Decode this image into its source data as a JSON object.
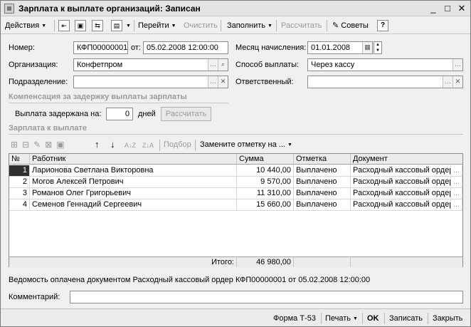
{
  "window": {
    "title": "Зарплата к выплате организаций: Записан",
    "minimize_glyph": "_",
    "maximize_glyph": "□",
    "close_glyph": "✕"
  },
  "toolbar": {
    "actions": "Действия",
    "goto": "Перейти",
    "clear": "Очистить",
    "fill": "Заполнить",
    "calculate": "Рассчитать",
    "tips": "Советы",
    "help": "?"
  },
  "header": {
    "number_label": "Номер:",
    "number_value": "КФП00000001",
    "date_label": "от:",
    "date_value": "05.02.2008 12:00:00",
    "month_label": "Месяц начисления:",
    "month_value": "01.01.2008",
    "org_label": "Организация:",
    "org_value": "Конфетпром",
    "payment_label": "Способ выплаты:",
    "payment_value": "Через кассу",
    "division_label": "Подразделение:",
    "division_value": "",
    "responsible_label": "Ответственный:",
    "responsible_value": ""
  },
  "compensation": {
    "title": "Компенсация за задержку выплаты зарплаты",
    "delay_label": "Выплата задержана на:",
    "delay_value": "0",
    "days_label": "дней",
    "calc_button": "Рассчитать"
  },
  "salary_section": {
    "title": "Зарплата к выплате",
    "selection": "Подбор",
    "replace_mark": "Замените отметку на ..."
  },
  "table": {
    "columns": [
      "№",
      "Работник",
      "Сумма",
      "Отметка",
      "Документ"
    ],
    "rows": [
      {
        "n": "1",
        "employee": "Ларионова Светлана Викторовна",
        "amount": "10 440,00",
        "mark": "Выплачено",
        "document": "Расходный кассовый ордер ..."
      },
      {
        "n": "2",
        "employee": "Могов Алексей Петрович",
        "amount": "9 570,00",
        "mark": "Выплачено",
        "document": "Расходный кассовый ордер ..."
      },
      {
        "n": "3",
        "employee": "Романов Олег Григорьевич",
        "amount": "11 310,00",
        "mark": "Выплачено",
        "document": "Расходный кассовый ордер ..."
      },
      {
        "n": "4",
        "employee": "Семенов Геннадий Сергеевич",
        "amount": "15 660,00",
        "mark": "Выплачено",
        "document": "Расходный кассовый ордер ..."
      }
    ],
    "total_label": "Итого:",
    "total_value": "46 980,00"
  },
  "footer": {
    "paid_info": "Ведомость оплачена документом Расходный кассовый ордер КФП00000001 от 05.02.2008 12:00:00",
    "comment_label": "Комментарий:",
    "comment_value": ""
  },
  "statusbar": {
    "form": "Форма Т-53",
    "print": "Печать",
    "ok": "OK",
    "save": "Записать",
    "close": "Закрыть"
  }
}
